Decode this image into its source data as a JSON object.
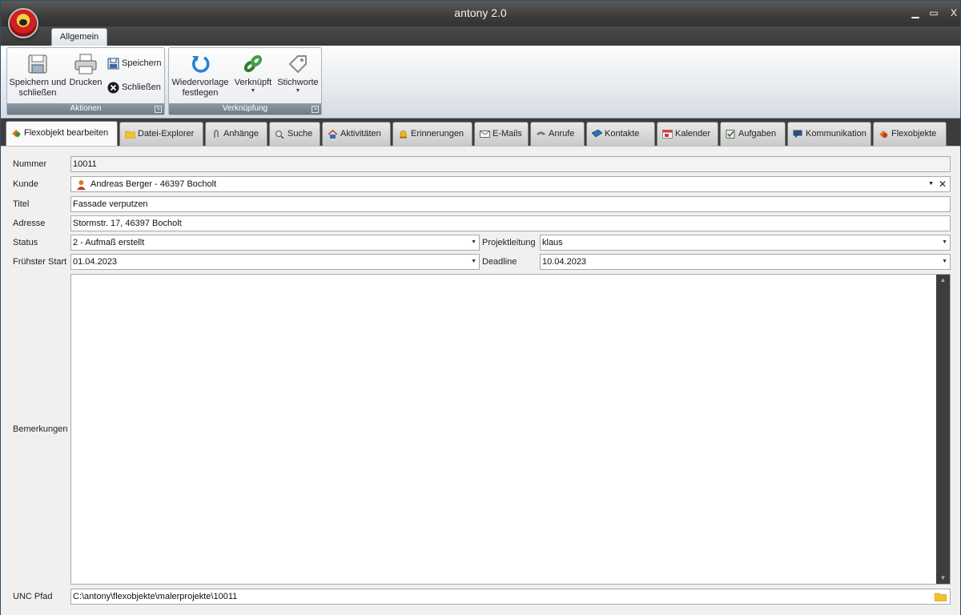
{
  "window": {
    "title": "antony 2.0",
    "minimize": "▁",
    "maximize": "▭",
    "close": "X"
  },
  "ribbon": {
    "tab_label": "Allgemein",
    "groups": {
      "aktionen": {
        "label": "Aktionen",
        "save_close_line1": "Speichern und",
        "save_close_line2": "schließen",
        "print": "Drucken",
        "save": "Speichern",
        "close": "Schließen"
      },
      "verknuepfung": {
        "label": "Verknüpfung",
        "followup_line1": "Wiedervorlage",
        "followup_line2": "festlegen",
        "linked": "Verknüpft",
        "keywords": "Stichworte"
      }
    }
  },
  "doc_tabs": [
    {
      "label": "Flexobjekt bearbeiten",
      "active": true
    },
    {
      "label": "Datei-Explorer"
    },
    {
      "label": "Anhänge"
    },
    {
      "label": "Suche"
    },
    {
      "label": "Aktivitäten"
    },
    {
      "label": "Erinnerungen"
    },
    {
      "label": "E-Mails"
    },
    {
      "label": "Anrufe"
    },
    {
      "label": "Kontakte"
    },
    {
      "label": "Kalender"
    },
    {
      "label": "Aufgaben"
    },
    {
      "label": "Kommunikation"
    },
    {
      "label": "Flexobjekte"
    }
  ],
  "form": {
    "nummer": {
      "label": "Nummer",
      "value": "10011"
    },
    "kunde": {
      "label": "Kunde",
      "value": "Andreas Berger - 46397 Bocholt"
    },
    "titel": {
      "label": "Titel",
      "value": "Fassade verputzen"
    },
    "adresse": {
      "label": "Adresse",
      "value": "Stormstr. 17, 46397 Bocholt"
    },
    "status": {
      "label": "Status",
      "value": "2 - Aufmaß erstellt"
    },
    "projektleitung": {
      "label": "Projektleitung",
      "value": "klaus"
    },
    "fruehster_start": {
      "label": "Frühster Start",
      "value": "01.04.2023"
    },
    "deadline": {
      "label": "Deadline",
      "value": "10.04.2023"
    },
    "bemerkungen": {
      "label": "Bemerkungen",
      "value": ""
    },
    "unc_pfad": {
      "label": "UNC Pfad",
      "value": "C:\\antony\\flexobjekte\\malerprojekte\\10011"
    }
  },
  "colors": {
    "titlebar": "#3c3c3c",
    "ribbon_group_label": "#7f8a96",
    "folder": "#f2c12e"
  }
}
